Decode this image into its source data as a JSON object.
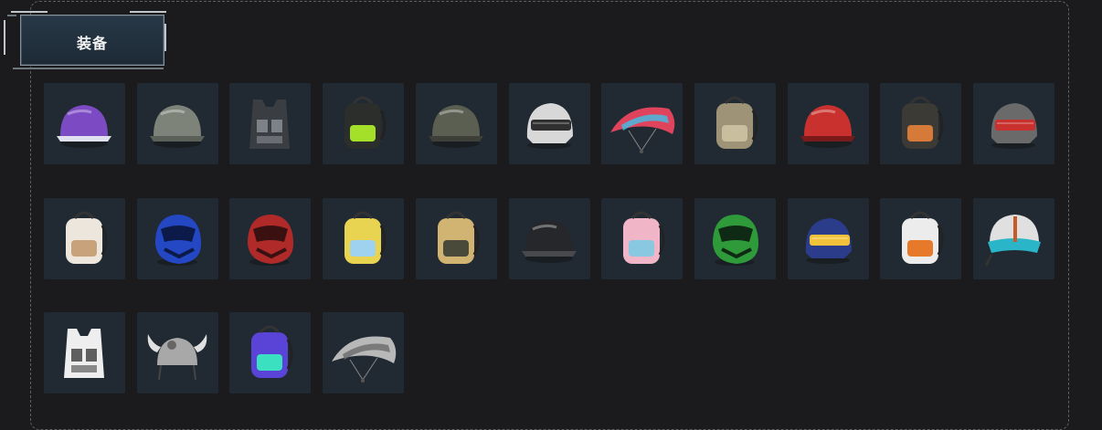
{
  "section": {
    "title": "装备"
  },
  "items": [
    {
      "icon": "purple-goggle-helmet-icon",
      "kind": "helmet",
      "main": "#7c4bc4",
      "accent": "#e0e0f0"
    },
    {
      "icon": "gray-helmet-icon",
      "kind": "helmet",
      "main": "#7d8378",
      "accent": "#5b6158"
    },
    {
      "icon": "tactical-vest-icon",
      "kind": "vest",
      "main": "#3a3d42",
      "accent": "#9aa0a6"
    },
    {
      "icon": "black-green-backpack-icon",
      "kind": "backpack",
      "main": "#2b2e2b",
      "accent": "#a4e02a"
    },
    {
      "icon": "military-helmet-icon",
      "kind": "helmet",
      "main": "#5a5f51",
      "accent": "#3d3f38"
    },
    {
      "icon": "white-visor-helmet-icon",
      "kind": "visor",
      "main": "#d8d8d8",
      "accent": "#303030"
    },
    {
      "icon": "colorful-parachute-icon",
      "kind": "parachute",
      "main": "#e0445c",
      "accent": "#3cc2e8"
    },
    {
      "icon": "canvas-backpack-icon",
      "kind": "backpack",
      "main": "#9e9376",
      "accent": "#c9bf9f"
    },
    {
      "icon": "red-devil-helmet-icon",
      "kind": "helmet",
      "main": "#c8312d",
      "accent": "#7a1a1a"
    },
    {
      "icon": "dark-backpack-icon",
      "kind": "backpack",
      "main": "#3b3a35",
      "accent": "#d67a3a"
    },
    {
      "icon": "red-visor-helmet-icon",
      "kind": "visor",
      "main": "#6a6a6a",
      "accent": "#c8312d"
    },
    {
      "icon": "bear-backpack-icon",
      "kind": "backpack",
      "main": "#ece6dc",
      "accent": "#c7a27a"
    },
    {
      "icon": "blue-moto-helmet-icon",
      "kind": "moto",
      "main": "#2447c4",
      "accent": "#0c1a4a"
    },
    {
      "icon": "red-moto-helmet-icon",
      "kind": "moto",
      "main": "#b02a2a",
      "accent": "#3a1010"
    },
    {
      "icon": "bee-backpack-icon",
      "kind": "backpack",
      "main": "#e8d450",
      "accent": "#9fd2ef"
    },
    {
      "icon": "dog-backpack-icon",
      "kind": "backpack",
      "main": "#d2b472",
      "accent": "#4a4a3a"
    },
    {
      "icon": "black-combat-helmet-icon",
      "kind": "helmet",
      "main": "#26272a",
      "accent": "#48494d"
    },
    {
      "icon": "pink-backpack-icon",
      "kind": "backpack",
      "main": "#f0b6c8",
      "accent": "#88c8e0"
    },
    {
      "icon": "green-moto-helmet-icon",
      "kind": "moto",
      "main": "#2e9a3a",
      "accent": "#0f2a14"
    },
    {
      "icon": "blue-starry-helmet-icon",
      "kind": "visor",
      "main": "#2a3c8a",
      "accent": "#f2c33a"
    },
    {
      "icon": "white-orange-backpack-icon",
      "kind": "backpack",
      "main": "#ececec",
      "accent": "#e67a2a"
    },
    {
      "icon": "pilot-helmet-icon",
      "kind": "pilot",
      "main": "#e0e0e0",
      "accent": "#2ab6c8"
    },
    {
      "icon": "graffiti-vest-icon",
      "kind": "vest",
      "main": "#eeeeee",
      "accent": "#222222"
    },
    {
      "icon": "viking-helmet-icon",
      "kind": "viking",
      "main": "#a8a8a8",
      "accent": "#e0e0e0"
    },
    {
      "icon": "neon-backpack-icon",
      "kind": "backpack",
      "main": "#5a44d8",
      "accent": "#3ae0c0"
    },
    {
      "icon": "gray-camo-parachute-icon",
      "kind": "parachute",
      "main": "#b8b8b8",
      "accent": "#6a6a6a"
    }
  ]
}
